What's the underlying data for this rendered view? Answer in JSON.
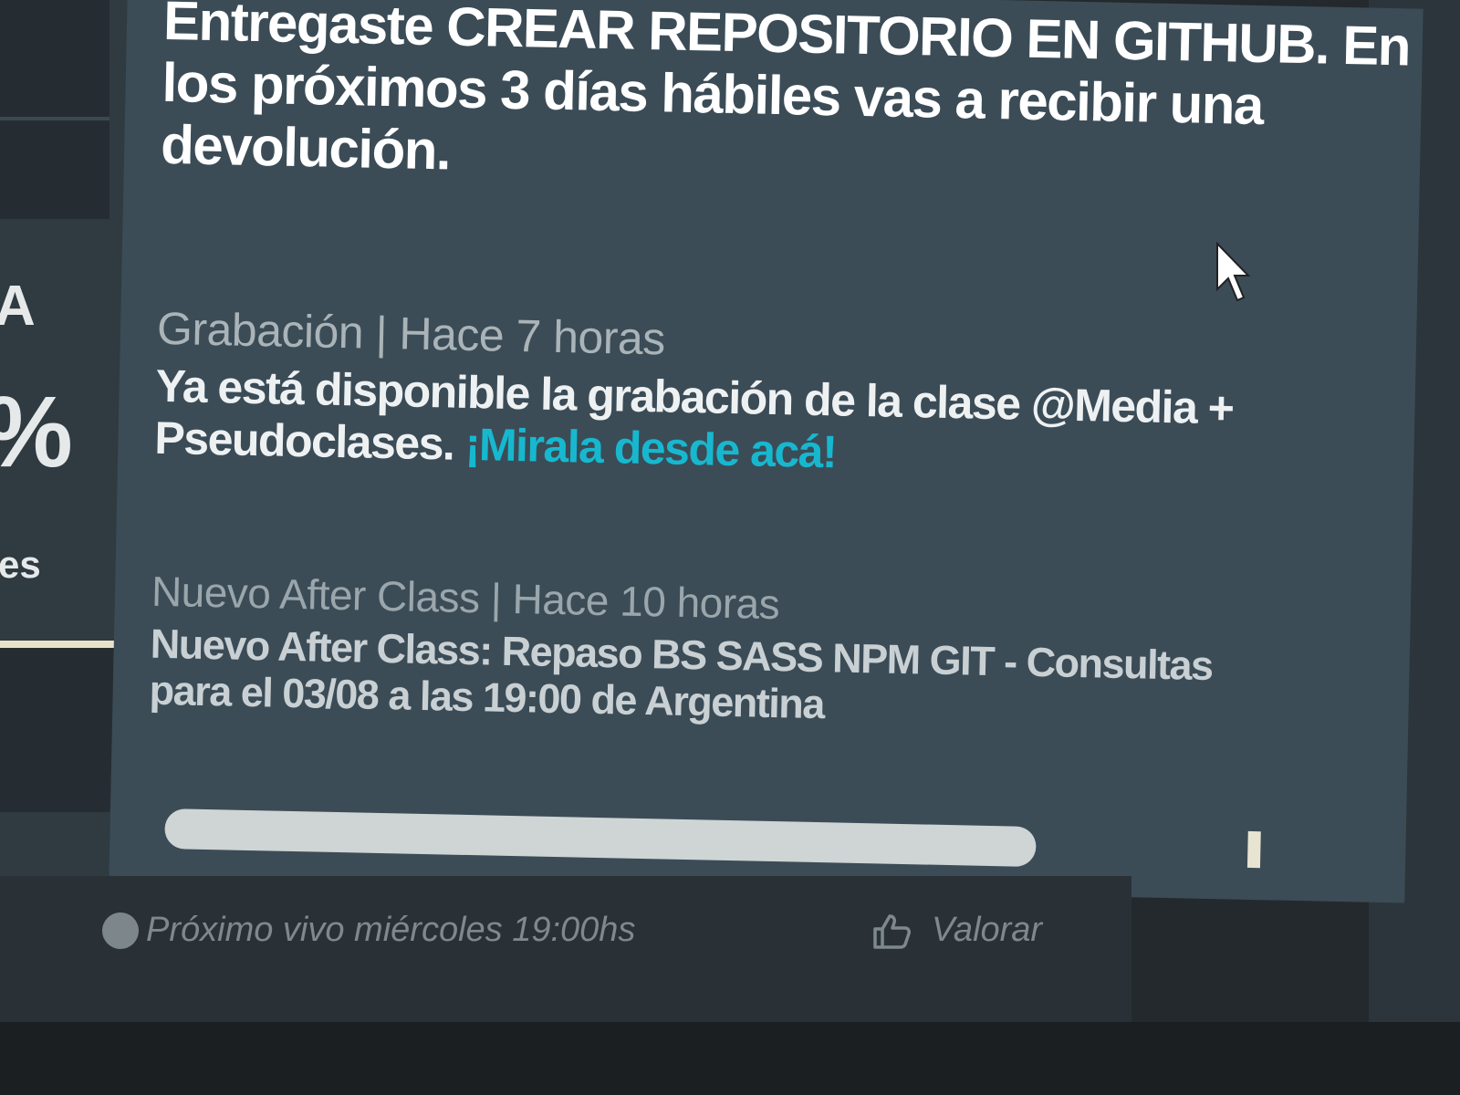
{
  "sidebar": {
    "letter": "A",
    "percent": "%",
    "suffix": "es"
  },
  "notifications": [
    {
      "meta": "",
      "body_prefix": "Entregaste",
      "body_bold": "CREAR REPOSITORIO EN GITHUB.",
      "body_suffix": "En los próximos 3 días hábiles vas a recibir una devolución."
    },
    {
      "meta": "Grabación | Hace 7 horas",
      "body": "Ya está disponible la grabación de la clase @Media + Pseudoclases.",
      "link": "¡Mirala desde acá!"
    },
    {
      "meta": "Nuevo After Class | Hace 10 horas",
      "body": "Nuevo After Class: Repaso BS SASS NPM GIT - Consultas para el 03/08 a las 19:00 de Argentina"
    }
  ],
  "footer": {
    "status": "Próximo vivo miércoles 19:00hs",
    "rate_label": "Valorar"
  },
  "icons": {
    "cursor": "arrow-cursor-icon",
    "status": "status-dot-icon",
    "rate": "thumbs-up-icon"
  },
  "colors": {
    "card_bg": "#3b4c57",
    "link": "#17b8cf",
    "text": "#ffffff",
    "meta": "#aab4b8"
  }
}
